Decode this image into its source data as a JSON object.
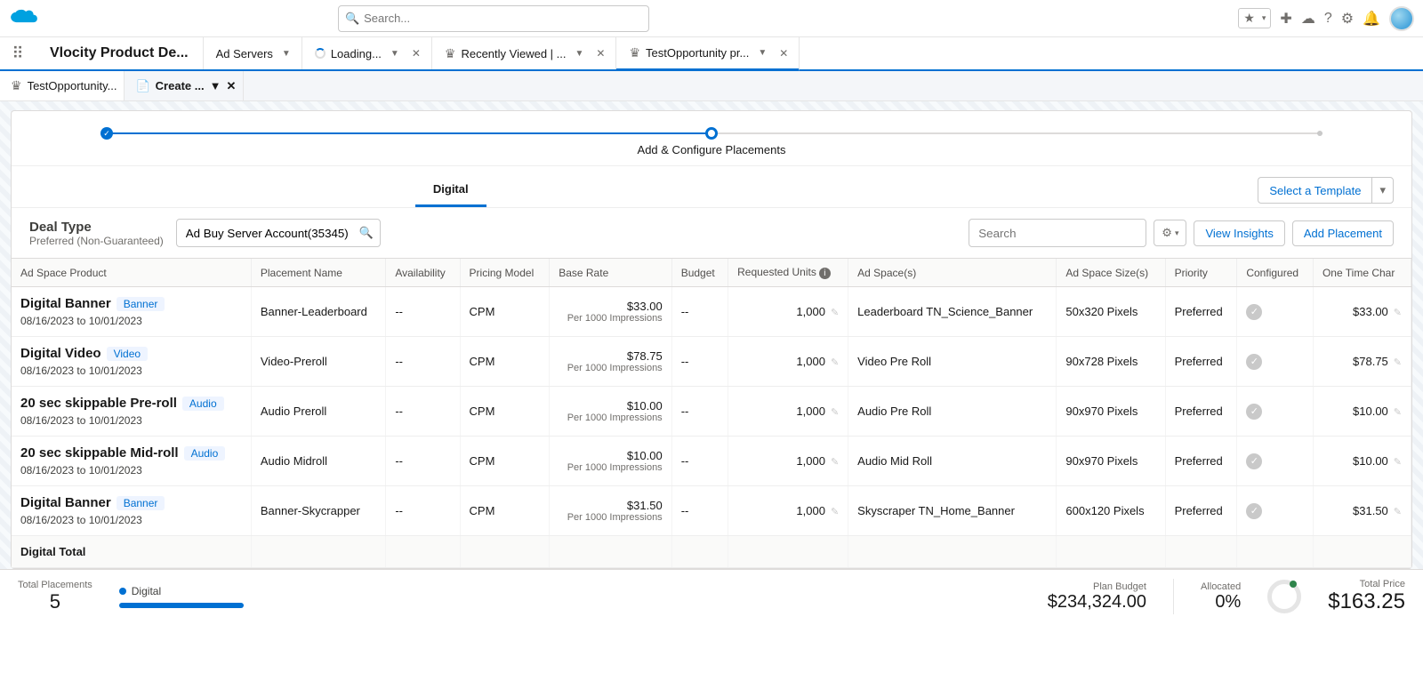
{
  "search_placeholder": "Search...",
  "app_name": "Vlocity Product De...",
  "nav": [
    {
      "label": "Ad Servers",
      "icon": "",
      "chev": true
    },
    {
      "label": "Loading...",
      "icon": "spinner",
      "chev": true,
      "close": true
    },
    {
      "label": "Recently Viewed | ...",
      "icon": "crown",
      "chev": true,
      "close": true
    },
    {
      "label": "TestOpportunity pr...",
      "icon": "crown",
      "chev": true,
      "close": true,
      "active": true
    }
  ],
  "subtabs": [
    {
      "label": "TestOpportunity...",
      "icon": "crown"
    },
    {
      "label": "Create ...",
      "icon": "doc",
      "active": true,
      "chev": true,
      "close": true
    }
  ],
  "stepper_label": "Add & Configure Placements",
  "page_tab": "Digital",
  "template_btn": "Select a Template",
  "deal_type_label": "Deal Type",
  "deal_type_value": "Preferred (Non-Guaranteed)",
  "account_search_value": "Ad Buy Server Account(35345)",
  "search2_placeholder": "Search",
  "view_insights": "View Insights",
  "add_placement": "Add Placement",
  "columns": [
    "Ad Space Product",
    "Placement Name",
    "Availability",
    "Pricing Model",
    "Base Rate",
    "Budget",
    "Requested Units",
    "Ad Space(s)",
    "Ad Space Size(s)",
    "Priority",
    "Configured",
    "One Time Char"
  ],
  "per_label": "Per 1000 Impressions",
  "rows": [
    {
      "product": "Digital Banner",
      "tag": "Banner",
      "dates": "08/16/2023 to 10/01/2023",
      "placement": "Banner-Leaderboard",
      "avail": "--",
      "model": "CPM",
      "rate": "$33.00",
      "budget": "--",
      "units": "1,000",
      "space": "Leaderboard TN_Science_Banner",
      "size": "50x320 Pixels",
      "priority": "Preferred",
      "charge": "$33.00"
    },
    {
      "product": "Digital Video",
      "tag": "Video",
      "dates": "08/16/2023 to 10/01/2023",
      "placement": "Video-Preroll",
      "avail": "--",
      "model": "CPM",
      "rate": "$78.75",
      "budget": "--",
      "units": "1,000",
      "space": "Video Pre Roll",
      "size": "90x728 Pixels",
      "priority": "Preferred",
      "charge": "$78.75"
    },
    {
      "product": "20 sec skippable Pre-roll",
      "tag": "Audio",
      "dates": "08/16/2023 to 10/01/2023",
      "placement": "Audio Preroll",
      "avail": "--",
      "model": "CPM",
      "rate": "$10.00",
      "budget": "--",
      "units": "1,000",
      "space": "Audio Pre Roll",
      "size": "90x970 Pixels",
      "priority": "Preferred",
      "charge": "$10.00"
    },
    {
      "product": "20 sec skippable Mid-roll",
      "tag": "Audio",
      "dates": "08/16/2023 to 10/01/2023",
      "placement": "Audio Midroll",
      "avail": "--",
      "model": "CPM",
      "rate": "$10.00",
      "budget": "--",
      "units": "1,000",
      "space": "Audio Mid Roll",
      "size": "90x970 Pixels",
      "priority": "Preferred",
      "charge": "$10.00"
    },
    {
      "product": "Digital Banner",
      "tag": "Banner",
      "dates": "08/16/2023 to 10/01/2023",
      "placement": "Banner-Skycrapper",
      "avail": "--",
      "model": "CPM",
      "rate": "$31.50",
      "budget": "--",
      "units": "1,000",
      "space": "Skyscraper TN_Home_Banner",
      "size": "600x120 Pixels",
      "priority": "Preferred",
      "charge": "$31.50"
    }
  ],
  "digital_total_label": "Digital Total",
  "footer": {
    "placements_label": "Total Placements",
    "placements_count": "5",
    "legend": "Digital",
    "plan_budget_label": "Plan Budget",
    "plan_budget": "$234,324.00",
    "allocated_label": "Allocated",
    "allocated": "0%",
    "total_price_label": "Total Price",
    "total_price": "$163.25"
  }
}
